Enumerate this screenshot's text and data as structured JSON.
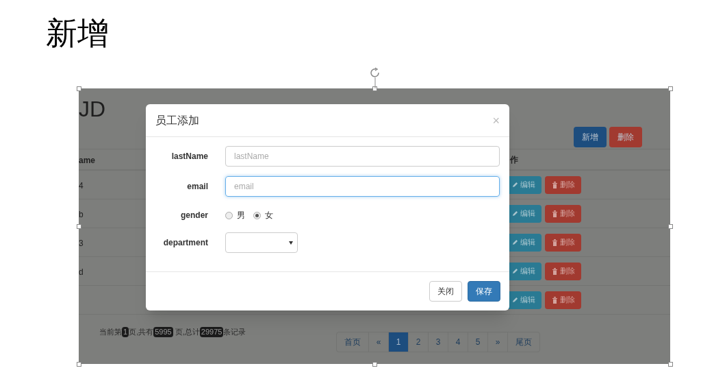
{
  "slide_title": "新增",
  "page": {
    "heading": "JD",
    "toolbar": [
      {
        "label": "新增",
        "kind": "primary"
      },
      {
        "label": "删除",
        "kind": "danger"
      }
    ],
    "table": {
      "columns": [
        "ame",
        "作"
      ],
      "rows": [
        {
          "column_1": "4",
          "actions": [
            {
              "label": "编辑",
              "kind": "edit"
            },
            {
              "label": "删除",
              "kind": "delete"
            }
          ]
        },
        {
          "column_1": "b",
          "actions": [
            {
              "label": "编辑",
              "kind": "edit"
            },
            {
              "label": "删除",
              "kind": "delete"
            }
          ]
        },
        {
          "column_1": "3",
          "actions": [
            {
              "label": "编辑",
              "kind": "edit"
            },
            {
              "label": "删除",
              "kind": "delete"
            }
          ]
        },
        {
          "column_1": "d",
          "actions": [
            {
              "label": "编辑",
              "kind": "edit"
            },
            {
              "label": "删除",
              "kind": "delete"
            }
          ]
        },
        {
          "actions": [
            {
              "label": "编辑",
              "kind": "edit"
            },
            {
              "label": "删除",
              "kind": "delete"
            }
          ]
        }
      ]
    },
    "summary": [
      {
        "kind": "text",
        "text": "当前第"
      },
      {
        "kind": "badge",
        "text": "1"
      },
      {
        "kind": "text",
        "text": "页,共有"
      },
      {
        "kind": "badge",
        "text": "5995"
      },
      {
        "kind": "text",
        "text": " 页,总计"
      },
      {
        "kind": "badge",
        "text": "29975"
      },
      {
        "kind": "text",
        "text": "条记录"
      }
    ],
    "pagination": [
      {
        "label": "首页",
        "selected": false
      },
      {
        "label": "«",
        "selected": false
      },
      {
        "label": "1",
        "selected": true
      },
      {
        "label": "2",
        "selected": false
      },
      {
        "label": "3",
        "selected": false
      },
      {
        "label": "4",
        "selected": false
      },
      {
        "label": "5",
        "selected": false
      },
      {
        "label": "»",
        "selected": false
      },
      {
        "label": "尾页",
        "selected": false
      }
    ]
  },
  "modal": {
    "title": "员工添加",
    "close": "×",
    "fields": [
      {
        "kind": "text",
        "label": "lastName",
        "placeholder": "lastName",
        "focused": false
      },
      {
        "kind": "text",
        "label": "email",
        "placeholder": "email",
        "focused": true
      },
      {
        "kind": "radio",
        "label": "gender",
        "options": [
          {
            "label": "男",
            "selected": false
          },
          {
            "label": "女",
            "selected": true
          }
        ]
      },
      {
        "kind": "select",
        "label": "department"
      }
    ],
    "buttons": [
      {
        "label": "关闭",
        "kind": "default"
      },
      {
        "label": "保存",
        "kind": "primary"
      }
    ]
  }
}
